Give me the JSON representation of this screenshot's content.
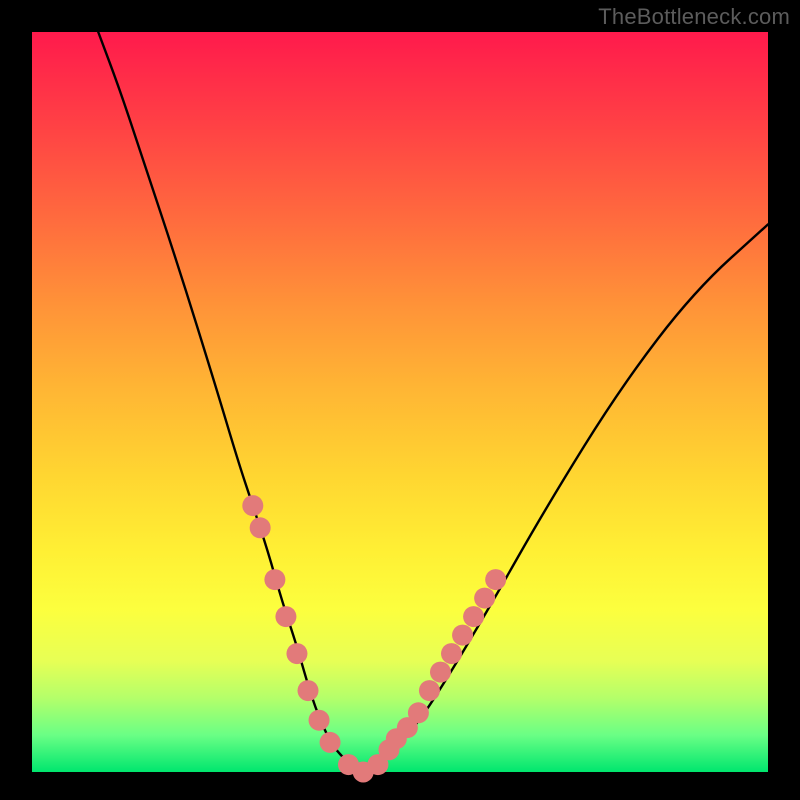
{
  "watermark": "TheBottleneck.com",
  "chart_data": {
    "type": "line",
    "title": "",
    "xlabel": "",
    "ylabel": "",
    "xlim": [
      0,
      100
    ],
    "ylim": [
      0,
      100
    ],
    "series": [
      {
        "name": "curve",
        "x": [
          9,
          12,
          15,
          20,
          25,
          28,
          30,
          32,
          34,
          36,
          38,
          40,
          42,
          45,
          48,
          52,
          56,
          62,
          70,
          80,
          90,
          100
        ],
        "y": [
          100,
          92,
          83,
          68,
          52,
          42,
          36,
          30,
          23,
          17,
          10,
          5,
          2,
          0,
          2,
          6,
          12,
          22,
          36,
          52,
          65,
          74
        ]
      }
    ],
    "markers": [
      {
        "x": 30,
        "y": 36
      },
      {
        "x": 31,
        "y": 33
      },
      {
        "x": 33,
        "y": 26
      },
      {
        "x": 34.5,
        "y": 21
      },
      {
        "x": 36,
        "y": 16
      },
      {
        "x": 37.5,
        "y": 11
      },
      {
        "x": 39,
        "y": 7
      },
      {
        "x": 40.5,
        "y": 4
      },
      {
        "x": 43,
        "y": 1
      },
      {
        "x": 45,
        "y": 0
      },
      {
        "x": 47,
        "y": 1
      },
      {
        "x": 48.5,
        "y": 3
      },
      {
        "x": 49.5,
        "y": 4.5
      },
      {
        "x": 51,
        "y": 6
      },
      {
        "x": 52.5,
        "y": 8
      },
      {
        "x": 54,
        "y": 11
      },
      {
        "x": 55.5,
        "y": 13.5
      },
      {
        "x": 57,
        "y": 16
      },
      {
        "x": 58.5,
        "y": 18.5
      },
      {
        "x": 60,
        "y": 21
      },
      {
        "x": 61.5,
        "y": 23.5
      },
      {
        "x": 63,
        "y": 26
      }
    ],
    "marker_color": "#e27a7a",
    "curve_color": "#000000"
  }
}
